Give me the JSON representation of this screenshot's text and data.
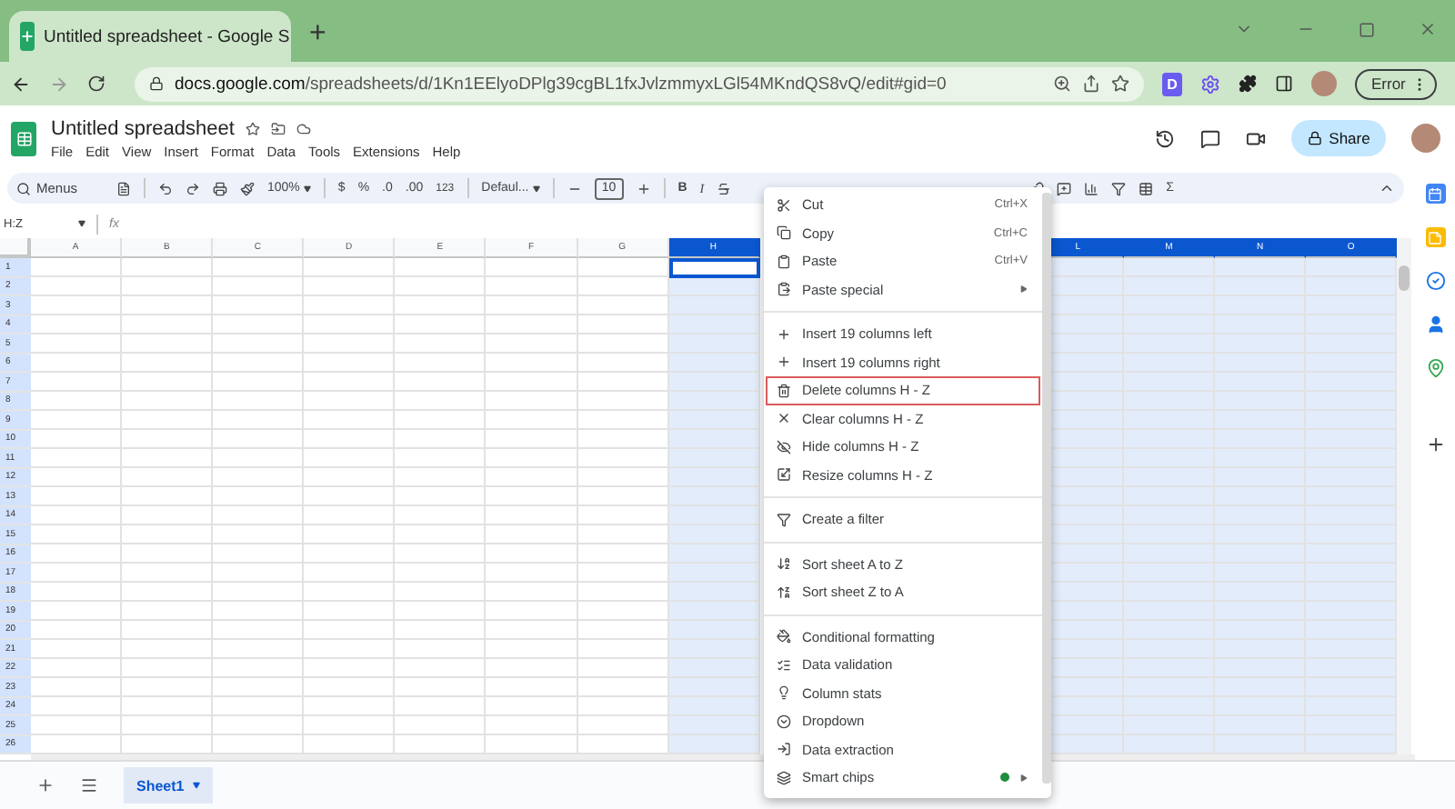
{
  "browser": {
    "tab_title": "Untitled spreadsheet - Google S",
    "new_tab": "+",
    "url_host": "docs.google.com",
    "url_path": "/spreadsheets/d/1Kn1EElyoDPlg39cgBL1fxJvlzmmyxLGl54MKndQS8vQ/edit#gid=0",
    "extension_letter": "D",
    "profile_button": "Error"
  },
  "doc": {
    "title": "Untitled spreadsheet",
    "menus": [
      "File",
      "Edit",
      "View",
      "Insert",
      "Format",
      "Data",
      "Tools",
      "Extensions",
      "Help"
    ],
    "share": "Share"
  },
  "toolbar": {
    "search": "Menus",
    "zoom": "100%",
    "currency": "$",
    "percent": "%",
    "decrease_decimal": ".0",
    "increase_decimal": ".00",
    "number_format": "123",
    "font": "Defaul...",
    "font_size": "10",
    "bold": "B",
    "italic": "I",
    "sum": "Σ"
  },
  "formula_bar": {
    "name_box": "H:Z",
    "fx": "fx"
  },
  "grid": {
    "columns": [
      {
        "label": "A",
        "selected": false,
        "active": false
      },
      {
        "label": "B",
        "selected": false,
        "active": false
      },
      {
        "label": "C",
        "selected": false,
        "active": false
      },
      {
        "label": "D",
        "selected": false,
        "active": false
      },
      {
        "label": "E",
        "selected": false,
        "active": false
      },
      {
        "label": "F",
        "selected": false,
        "active": false
      },
      {
        "label": "G",
        "selected": false,
        "active": false
      },
      {
        "label": "H",
        "selected": true,
        "active": true
      },
      {
        "label": "L",
        "selected": true,
        "active": false
      },
      {
        "label": "M",
        "selected": true,
        "active": false
      },
      {
        "label": "N",
        "selected": true,
        "active": false
      },
      {
        "label": "O",
        "selected": true,
        "active": false
      }
    ],
    "rows": [
      "1",
      "2",
      "3",
      "4",
      "5",
      "6",
      "7",
      "8",
      "9",
      "10",
      "11",
      "12",
      "13",
      "14",
      "15",
      "16",
      "17",
      "18",
      "19",
      "20",
      "21",
      "22",
      "23",
      "24",
      "25",
      "26"
    ]
  },
  "sheets": [
    {
      "name": "Sheet1",
      "selected": true
    }
  ],
  "context_menu": {
    "groups": [
      [
        {
          "label": "Cut",
          "shortcut": "Ctrl+X",
          "submenu": false,
          "highlighted": false,
          "dot": false
        },
        {
          "label": "Copy",
          "shortcut": "Ctrl+C",
          "submenu": false,
          "highlighted": false,
          "dot": false
        },
        {
          "label": "Paste",
          "shortcut": "Ctrl+V",
          "submenu": false,
          "highlighted": false,
          "dot": false
        },
        {
          "label": "Paste special",
          "submenu": true,
          "highlighted": false,
          "dot": false
        }
      ],
      [
        {
          "label": "Insert 19 columns left",
          "submenu": false,
          "highlighted": false,
          "dot": false
        },
        {
          "label": "Insert 19 columns right",
          "submenu": false,
          "highlighted": false,
          "dot": false
        },
        {
          "label": "Delete columns H - Z",
          "submenu": false,
          "highlighted": true,
          "dot": false
        },
        {
          "label": "Clear columns H - Z",
          "submenu": false,
          "highlighted": false,
          "dot": false
        },
        {
          "label": "Hide columns H - Z",
          "submenu": false,
          "highlighted": false,
          "dot": false
        },
        {
          "label": "Resize columns H - Z",
          "submenu": false,
          "highlighted": false,
          "dot": false
        }
      ],
      [
        {
          "label": "Create a filter",
          "submenu": false,
          "highlighted": false,
          "dot": false
        }
      ],
      [
        {
          "label": "Sort sheet A to Z",
          "submenu": false,
          "highlighted": false,
          "dot": false
        },
        {
          "label": "Sort sheet Z to A",
          "submenu": false,
          "highlighted": false,
          "dot": false
        }
      ],
      [
        {
          "label": "Conditional formatting",
          "submenu": false,
          "highlighted": false,
          "dot": false
        },
        {
          "label": "Data validation",
          "submenu": false,
          "highlighted": false,
          "dot": false
        },
        {
          "label": "Column stats",
          "submenu": false,
          "highlighted": false,
          "dot": false
        },
        {
          "label": "Dropdown",
          "submenu": false,
          "highlighted": false,
          "dot": false
        },
        {
          "label": "Data extraction",
          "submenu": false,
          "highlighted": false,
          "dot": false
        },
        {
          "label": "Smart chips",
          "submenu": true,
          "highlighted": false,
          "dot": true
        }
      ]
    ]
  }
}
